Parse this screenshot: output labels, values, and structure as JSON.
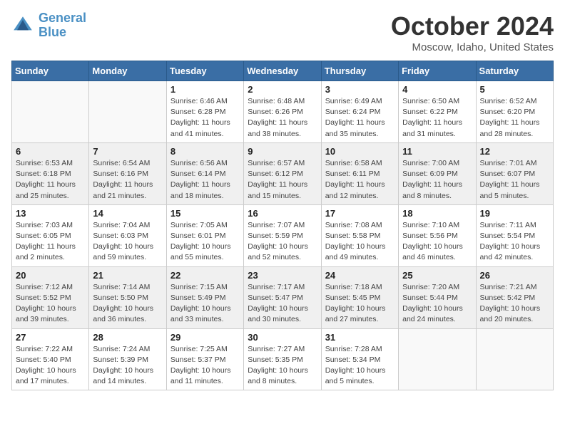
{
  "header": {
    "logo_line1": "General",
    "logo_line2": "Blue",
    "month_title": "October 2024",
    "location": "Moscow, Idaho, United States"
  },
  "days_of_week": [
    "Sunday",
    "Monday",
    "Tuesday",
    "Wednesday",
    "Thursday",
    "Friday",
    "Saturday"
  ],
  "weeks": [
    [
      {
        "day": "",
        "sunrise": "",
        "sunset": "",
        "daylight": ""
      },
      {
        "day": "",
        "sunrise": "",
        "sunset": "",
        "daylight": ""
      },
      {
        "day": "1",
        "sunrise": "Sunrise: 6:46 AM",
        "sunset": "Sunset: 6:28 PM",
        "daylight": "Daylight: 11 hours and 41 minutes."
      },
      {
        "day": "2",
        "sunrise": "Sunrise: 6:48 AM",
        "sunset": "Sunset: 6:26 PM",
        "daylight": "Daylight: 11 hours and 38 minutes."
      },
      {
        "day": "3",
        "sunrise": "Sunrise: 6:49 AM",
        "sunset": "Sunset: 6:24 PM",
        "daylight": "Daylight: 11 hours and 35 minutes."
      },
      {
        "day": "4",
        "sunrise": "Sunrise: 6:50 AM",
        "sunset": "Sunset: 6:22 PM",
        "daylight": "Daylight: 11 hours and 31 minutes."
      },
      {
        "day": "5",
        "sunrise": "Sunrise: 6:52 AM",
        "sunset": "Sunset: 6:20 PM",
        "daylight": "Daylight: 11 hours and 28 minutes."
      }
    ],
    [
      {
        "day": "6",
        "sunrise": "Sunrise: 6:53 AM",
        "sunset": "Sunset: 6:18 PM",
        "daylight": "Daylight: 11 hours and 25 minutes."
      },
      {
        "day": "7",
        "sunrise": "Sunrise: 6:54 AM",
        "sunset": "Sunset: 6:16 PM",
        "daylight": "Daylight: 11 hours and 21 minutes."
      },
      {
        "day": "8",
        "sunrise": "Sunrise: 6:56 AM",
        "sunset": "Sunset: 6:14 PM",
        "daylight": "Daylight: 11 hours and 18 minutes."
      },
      {
        "day": "9",
        "sunrise": "Sunrise: 6:57 AM",
        "sunset": "Sunset: 6:12 PM",
        "daylight": "Daylight: 11 hours and 15 minutes."
      },
      {
        "day": "10",
        "sunrise": "Sunrise: 6:58 AM",
        "sunset": "Sunset: 6:11 PM",
        "daylight": "Daylight: 11 hours and 12 minutes."
      },
      {
        "day": "11",
        "sunrise": "Sunrise: 7:00 AM",
        "sunset": "Sunset: 6:09 PM",
        "daylight": "Daylight: 11 hours and 8 minutes."
      },
      {
        "day": "12",
        "sunrise": "Sunrise: 7:01 AM",
        "sunset": "Sunset: 6:07 PM",
        "daylight": "Daylight: 11 hours and 5 minutes."
      }
    ],
    [
      {
        "day": "13",
        "sunrise": "Sunrise: 7:03 AM",
        "sunset": "Sunset: 6:05 PM",
        "daylight": "Daylight: 11 hours and 2 minutes."
      },
      {
        "day": "14",
        "sunrise": "Sunrise: 7:04 AM",
        "sunset": "Sunset: 6:03 PM",
        "daylight": "Daylight: 10 hours and 59 minutes."
      },
      {
        "day": "15",
        "sunrise": "Sunrise: 7:05 AM",
        "sunset": "Sunset: 6:01 PM",
        "daylight": "Daylight: 10 hours and 55 minutes."
      },
      {
        "day": "16",
        "sunrise": "Sunrise: 7:07 AM",
        "sunset": "Sunset: 5:59 PM",
        "daylight": "Daylight: 10 hours and 52 minutes."
      },
      {
        "day": "17",
        "sunrise": "Sunrise: 7:08 AM",
        "sunset": "Sunset: 5:58 PM",
        "daylight": "Daylight: 10 hours and 49 minutes."
      },
      {
        "day": "18",
        "sunrise": "Sunrise: 7:10 AM",
        "sunset": "Sunset: 5:56 PM",
        "daylight": "Daylight: 10 hours and 46 minutes."
      },
      {
        "day": "19",
        "sunrise": "Sunrise: 7:11 AM",
        "sunset": "Sunset: 5:54 PM",
        "daylight": "Daylight: 10 hours and 42 minutes."
      }
    ],
    [
      {
        "day": "20",
        "sunrise": "Sunrise: 7:12 AM",
        "sunset": "Sunset: 5:52 PM",
        "daylight": "Daylight: 10 hours and 39 minutes."
      },
      {
        "day": "21",
        "sunrise": "Sunrise: 7:14 AM",
        "sunset": "Sunset: 5:50 PM",
        "daylight": "Daylight: 10 hours and 36 minutes."
      },
      {
        "day": "22",
        "sunrise": "Sunrise: 7:15 AM",
        "sunset": "Sunset: 5:49 PM",
        "daylight": "Daylight: 10 hours and 33 minutes."
      },
      {
        "day": "23",
        "sunrise": "Sunrise: 7:17 AM",
        "sunset": "Sunset: 5:47 PM",
        "daylight": "Daylight: 10 hours and 30 minutes."
      },
      {
        "day": "24",
        "sunrise": "Sunrise: 7:18 AM",
        "sunset": "Sunset: 5:45 PM",
        "daylight": "Daylight: 10 hours and 27 minutes."
      },
      {
        "day": "25",
        "sunrise": "Sunrise: 7:20 AM",
        "sunset": "Sunset: 5:44 PM",
        "daylight": "Daylight: 10 hours and 24 minutes."
      },
      {
        "day": "26",
        "sunrise": "Sunrise: 7:21 AM",
        "sunset": "Sunset: 5:42 PM",
        "daylight": "Daylight: 10 hours and 20 minutes."
      }
    ],
    [
      {
        "day": "27",
        "sunrise": "Sunrise: 7:22 AM",
        "sunset": "Sunset: 5:40 PM",
        "daylight": "Daylight: 10 hours and 17 minutes."
      },
      {
        "day": "28",
        "sunrise": "Sunrise: 7:24 AM",
        "sunset": "Sunset: 5:39 PM",
        "daylight": "Daylight: 10 hours and 14 minutes."
      },
      {
        "day": "29",
        "sunrise": "Sunrise: 7:25 AM",
        "sunset": "Sunset: 5:37 PM",
        "daylight": "Daylight: 10 hours and 11 minutes."
      },
      {
        "day": "30",
        "sunrise": "Sunrise: 7:27 AM",
        "sunset": "Sunset: 5:35 PM",
        "daylight": "Daylight: 10 hours and 8 minutes."
      },
      {
        "day": "31",
        "sunrise": "Sunrise: 7:28 AM",
        "sunset": "Sunset: 5:34 PM",
        "daylight": "Daylight: 10 hours and 5 minutes."
      },
      {
        "day": "",
        "sunrise": "",
        "sunset": "",
        "daylight": ""
      },
      {
        "day": "",
        "sunrise": "",
        "sunset": "",
        "daylight": ""
      }
    ]
  ]
}
